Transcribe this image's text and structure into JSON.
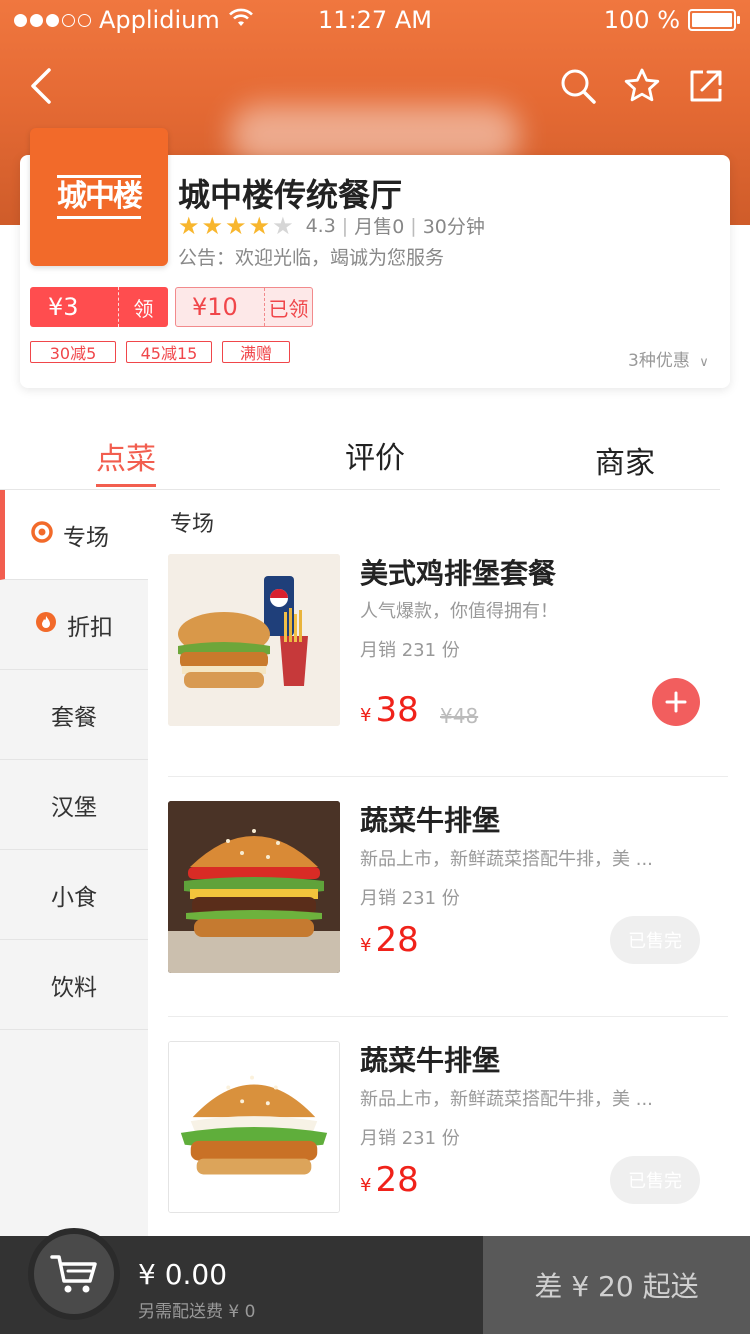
{
  "status_bar": {
    "carrier": "Applidium",
    "time": "11:27 AM",
    "battery": "100 %",
    "signal_dots_filled": 3,
    "signal_dots_total": 5
  },
  "nav": {
    "back_icon": "chevron-left-icon",
    "search_icon": "search-icon",
    "favorite_icon": "star-outline-icon",
    "share_icon": "share-external-icon"
  },
  "store": {
    "name": "城中楼传统餐厅",
    "rating": "4.3",
    "rating_stars": 4,
    "monthly_sales": "月售0",
    "delivery_time": "30分钟",
    "notice": "公告：欢迎光临，竭诚为您服务",
    "brand_color": "#f26a2a"
  },
  "coupons": [
    {
      "amount": "¥3",
      "action": "领"
    },
    {
      "amount": "¥10",
      "action": "已领"
    }
  ],
  "promo_tags": [
    "30减5",
    "45减15",
    "满赠"
  ],
  "promo_count": "3种优惠",
  "tabs": [
    "点菜",
    "评价",
    "商家"
  ],
  "sidebar": [
    {
      "label": "专场",
      "icon": "target-icon"
    },
    {
      "label": "折扣",
      "icon": "flame-icon"
    },
    {
      "label": "套餐"
    },
    {
      "label": "汉堡"
    },
    {
      "label": "小食"
    },
    {
      "label": "饮料"
    }
  ],
  "section_title": "专场",
  "items": [
    {
      "name": "美式鸡排堡套餐",
      "desc": "人气爆款，你值得拥有！",
      "sales": "月销 231 份",
      "currency": "¥",
      "price": "38",
      "old_price": "¥48",
      "action": "add",
      "action_icon": "plus-icon"
    },
    {
      "name": "蔬菜牛排堡",
      "desc": "新品上市，新鲜蔬菜搭配牛排，美 ...",
      "sales": "月销 231 份",
      "currency": "¥",
      "price": "28",
      "status": "已售完"
    },
    {
      "name": "蔬菜牛排堡",
      "desc": "新品上市，新鲜蔬菜搭配牛排，美 ...",
      "sales": "月销 231 份",
      "currency": "¥",
      "price": "28",
      "status": "已售完"
    }
  ],
  "cart": {
    "icon": "cart-icon",
    "total": "¥ 0.00",
    "delivery_fee": "另需配送费 ¥ 0",
    "checkout": "差 ¥ 20 起送"
  },
  "colors": {
    "accent": "#f25e4f",
    "price": "#f0221a",
    "header": "#e56a34",
    "bottom_bar": "#333333"
  }
}
